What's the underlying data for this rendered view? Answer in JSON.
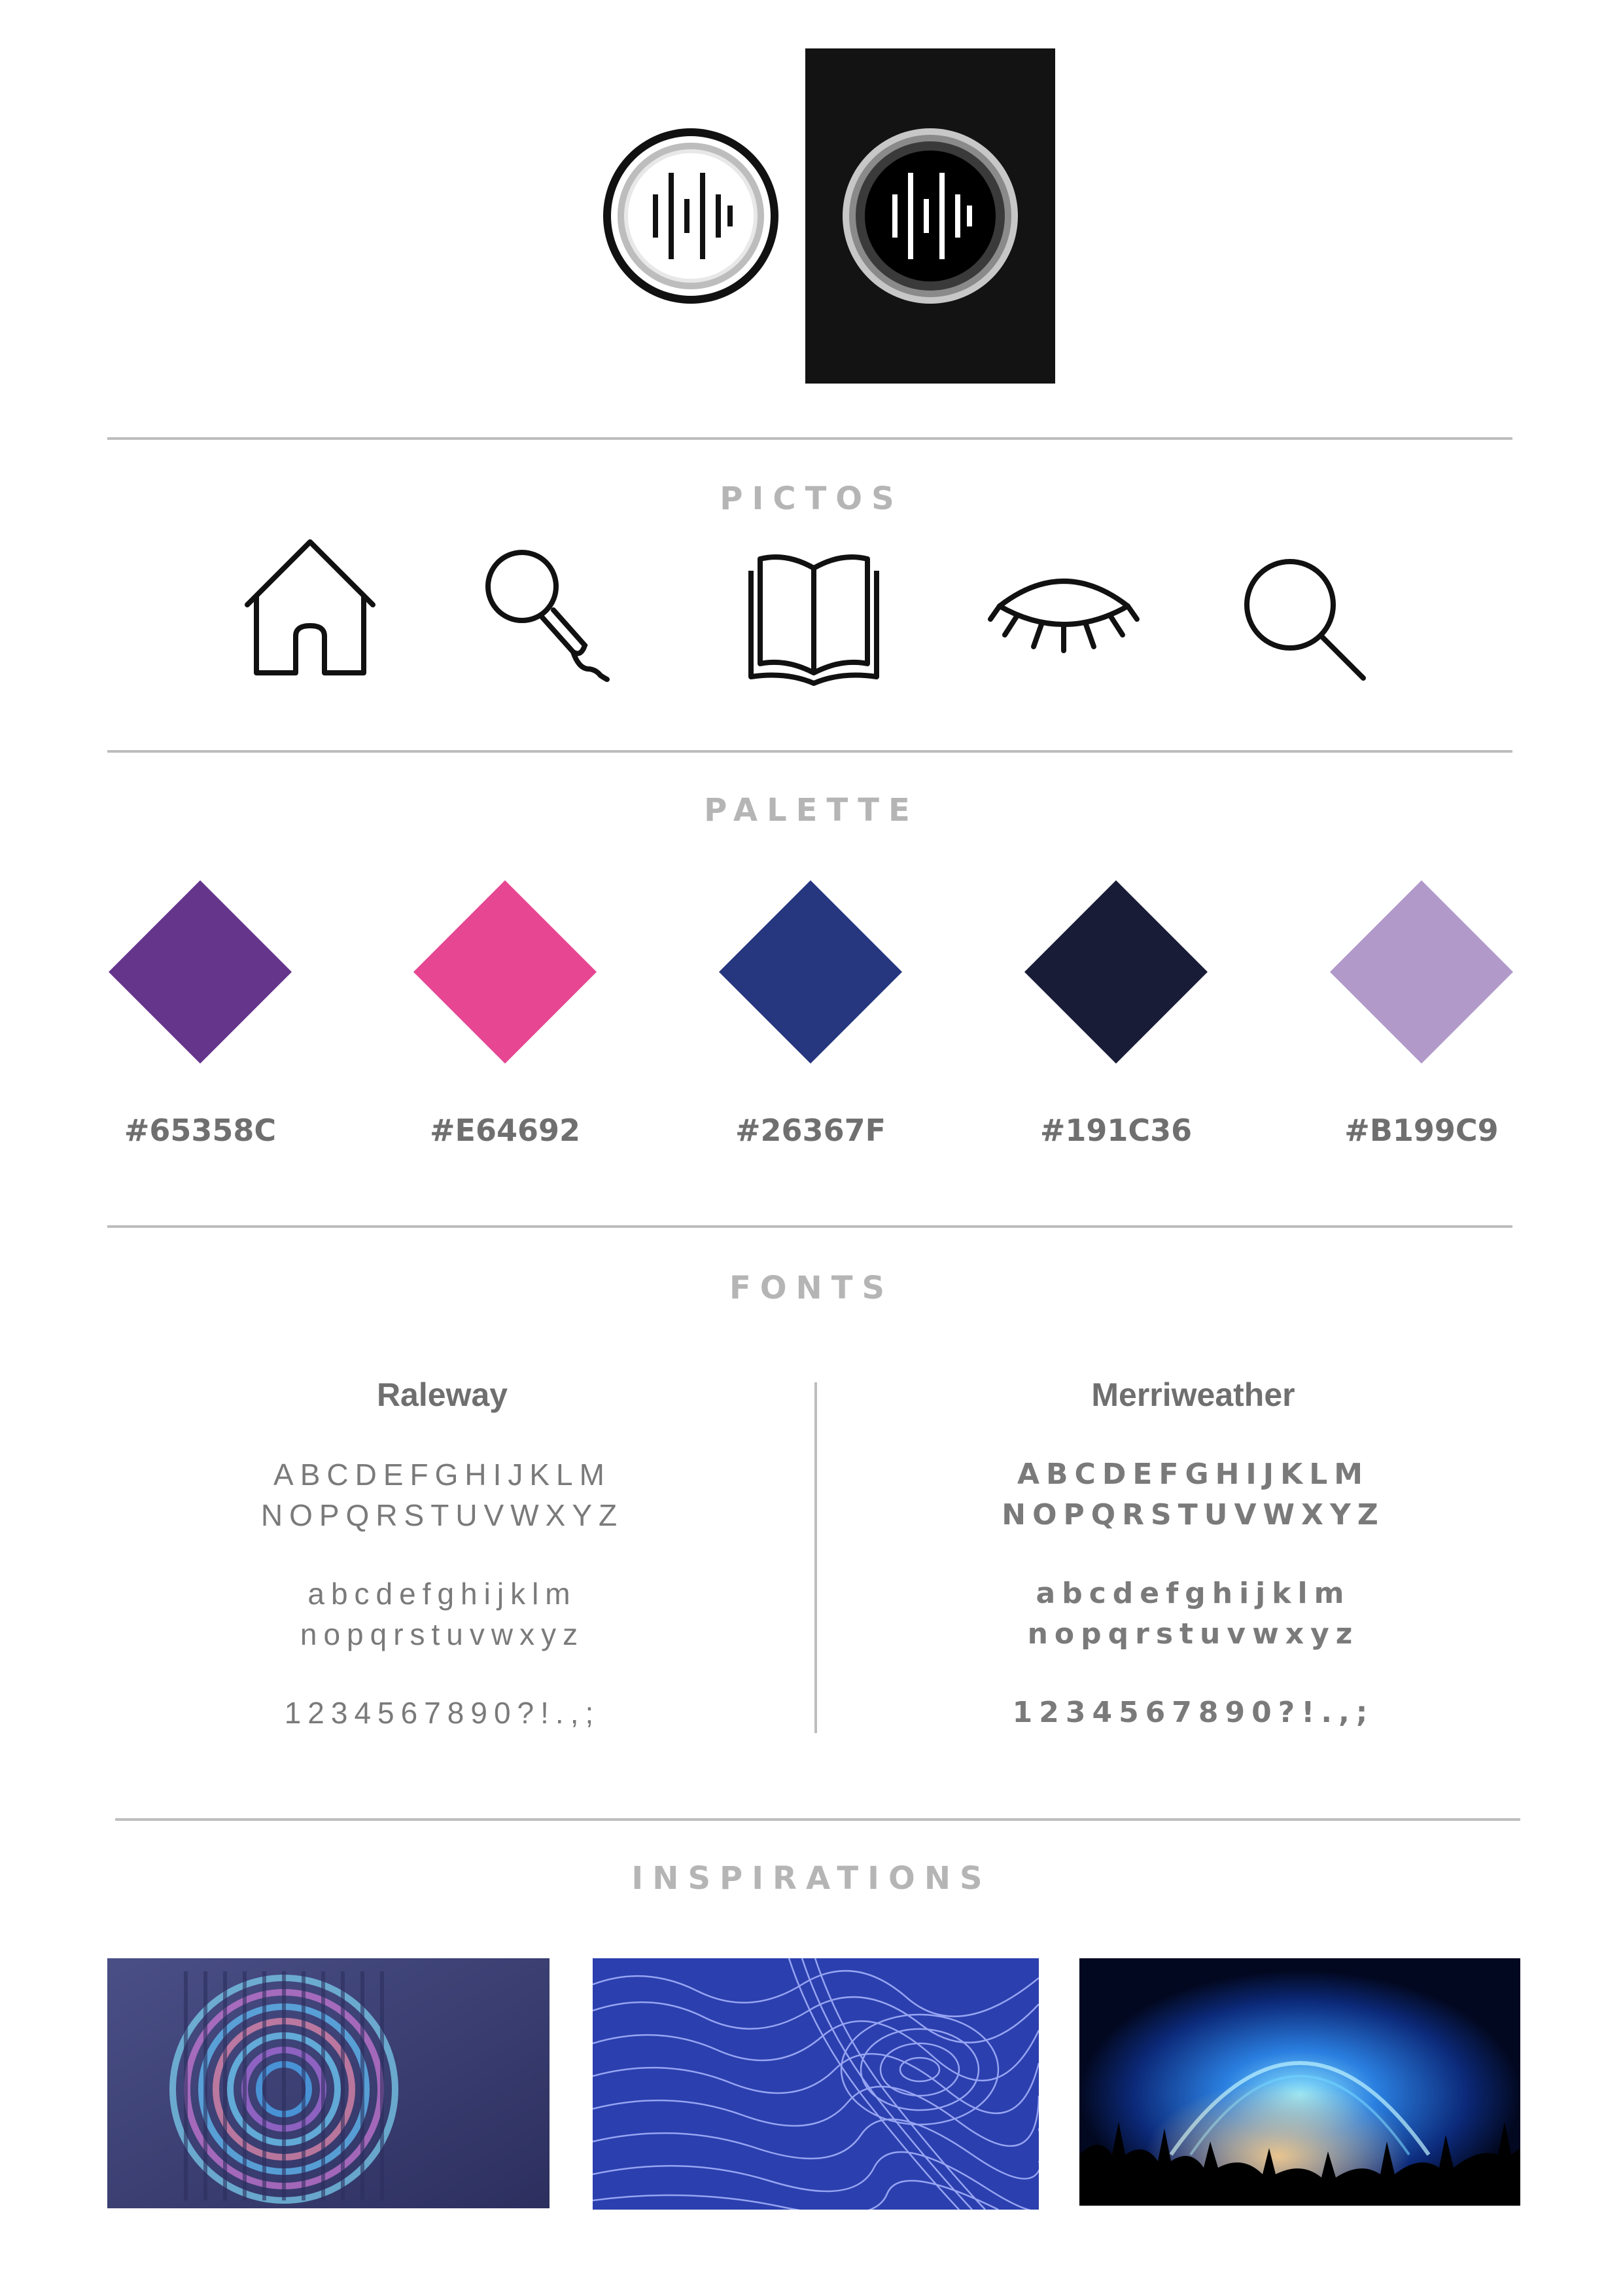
{
  "sections": {
    "pictos": "PICTOS",
    "palette": "PALETTE",
    "fonts": "FONTS",
    "inspirations": "INSPIRATIONS"
  },
  "logo": {
    "variants": [
      "light-background",
      "dark-background"
    ]
  },
  "pictos": [
    "house-icon",
    "microphone-icon",
    "open-book-icon",
    "closed-eye-icon",
    "magnifier-icon"
  ],
  "palette": [
    {
      "hex": "#65358C",
      "color": "#65358C"
    },
    {
      "hex": "#E64692",
      "color": "#E64692"
    },
    {
      "hex": "#26367F",
      "color": "#26367F"
    },
    {
      "hex": "#191C36",
      "color": "#191C36"
    },
    {
      "hex": "#B199C9",
      "color": "#B199C9"
    }
  ],
  "fonts": [
    {
      "name": "Raleway",
      "upper1": "ABCDEFGHIJKLM",
      "upper2": "NOPQRSTUVWXYZ",
      "lower1": "abcdefghijklm",
      "lower2": "nopqrstuvwxyz",
      "digits": "1234567890?!.,;"
    },
    {
      "name": "Merriweather",
      "upper1": "ABCDEFGHIJKLM",
      "upper2": "NOPQRSTUVWXYZ",
      "lower1": "abcdefghijklm",
      "lower2": "nopqrstuvwxyz",
      "digits": "1234567890?!.,;"
    }
  ],
  "inspirations": [
    "spiral-soundwave-image",
    "topographic-lines-image",
    "concert-stage-image"
  ]
}
